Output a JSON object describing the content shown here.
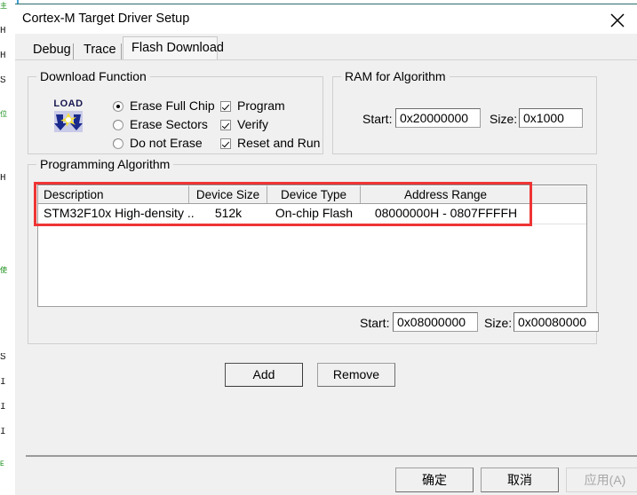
{
  "window": {
    "title": "Cortex-M Target Driver Setup",
    "close_icon": "close-icon"
  },
  "tabs": [
    {
      "label": "Debug",
      "active": false
    },
    {
      "label": "Trace",
      "active": false
    },
    {
      "label": "Flash Download",
      "active": true
    }
  ],
  "download_function": {
    "group_title": "Download Function",
    "icon_label": "LOAD",
    "radios": [
      {
        "label": "Erase Full Chip",
        "selected": true
      },
      {
        "label": "Erase Sectors",
        "selected": false
      },
      {
        "label": "Do not Erase",
        "selected": false
      }
    ],
    "checkboxes": [
      {
        "label": "Program",
        "checked": true
      },
      {
        "label": "Verify",
        "checked": true
      },
      {
        "label": "Reset and Run",
        "checked": true
      }
    ]
  },
  "ram_for_algorithm": {
    "group_title": "RAM for Algorithm",
    "start_label": "Start:",
    "start_value": "0x20000000",
    "size_label": "Size:",
    "size_value": "0x1000"
  },
  "programming_algorithm": {
    "group_title": "Programming Algorithm",
    "columns": [
      "Description",
      "Device Size",
      "Device Type",
      "Address Range"
    ],
    "rows": [
      {
        "description": "STM32F10x High-density ...",
        "device_size": "512k",
        "device_type": "On-chip Flash",
        "address_range": "08000000H - 0807FFFFH"
      }
    ],
    "start_label": "Start:",
    "start_value": "0x08000000",
    "size_label": "Size:",
    "size_value": "0x00080000"
  },
  "actions": {
    "add_label": "Add",
    "remove_label": "Remove"
  },
  "footer": {
    "ok_label": "确定",
    "cancel_label": "取消",
    "apply_label": "应用(A)"
  },
  "annotation": {
    "color": "#ef3434",
    "shape": "rectangle-highlight"
  },
  "background_editor": {
    "fragments": [
      "主",
      "H",
      "H",
      "S",
      "位",
      "H",
      "使",
      "S",
      "I",
      "I",
      "I",
      "E"
    ]
  }
}
